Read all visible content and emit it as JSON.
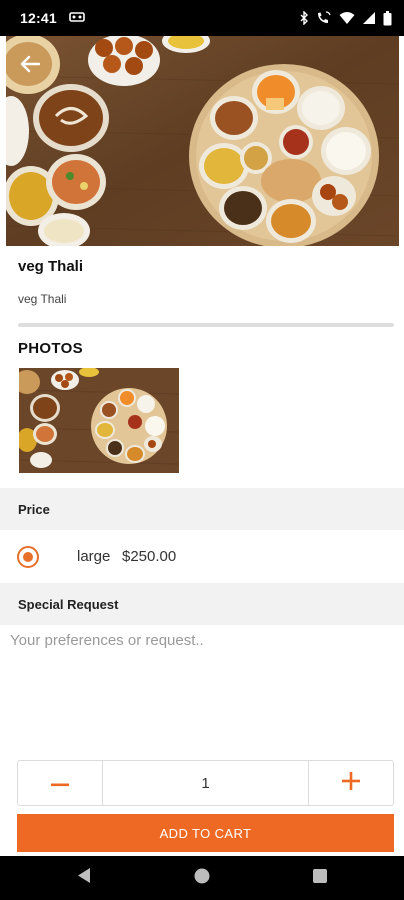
{
  "status_bar": {
    "time": "12:41",
    "left_icon": "cast-icon",
    "right_icons": [
      "bluetooth-icon",
      "wifi-calling-icon",
      "wifi-icon",
      "signal-icon",
      "battery-icon"
    ]
  },
  "hero": {
    "image": "thali-platter-photo",
    "back_icon": "arrow-left-icon"
  },
  "item": {
    "title": "veg Thali",
    "description": "veg Thali"
  },
  "photos": {
    "heading": "PHOTOS",
    "thumbnail": "thali-photo-thumbnail"
  },
  "price": {
    "header": "Price",
    "options": [
      {
        "size": "large",
        "amount": "$250.00",
        "selected": true
      }
    ]
  },
  "special_request": {
    "header": "Special Request",
    "placeholder": "Your preferences or request..",
    "value": ""
  },
  "quantity": {
    "value": "1",
    "minus_icon": "minus-icon",
    "plus_icon": "plus-icon"
  },
  "cart": {
    "button_label": "ADD TO CART"
  },
  "nav": {
    "back_icon": "nav-back-icon",
    "home_icon": "nav-home-icon",
    "recents_icon": "nav-recents-icon"
  },
  "colors": {
    "accent": "#ee6a24",
    "radio": "#e8702a",
    "section_bg": "#f2f2f2"
  }
}
